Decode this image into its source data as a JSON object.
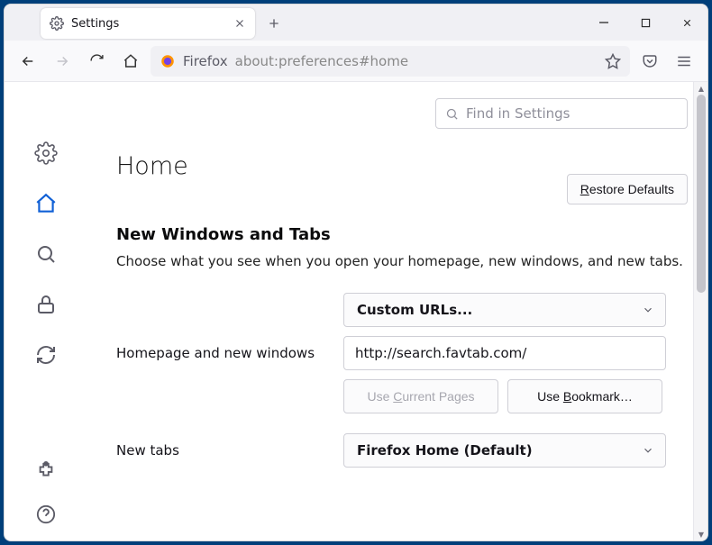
{
  "window": {
    "tab_title": "Settings"
  },
  "urlbar": {
    "identity_label": "Firefox",
    "url": "about:preferences#home"
  },
  "search": {
    "placeholder": "Find in Settings"
  },
  "page": {
    "title": "Home",
    "restore_label": "Restore Defaults",
    "restore_hotkey": "R"
  },
  "section": {
    "title": "New Windows and Tabs",
    "description": "Choose what you see when you open your homepage, new windows, and new tabs."
  },
  "homepage": {
    "label": "Homepage and new windows",
    "select_value": "Custom URLs...",
    "url_value": "http://search.favtab.com/",
    "use_current_label": "Use Current Pages",
    "use_current_hotkey": "C",
    "use_bookmark_label": "Use Bookmark…",
    "use_bookmark_hotkey": "B"
  },
  "newtabs": {
    "label": "New tabs",
    "select_value": "Firefox Home (Default)"
  }
}
